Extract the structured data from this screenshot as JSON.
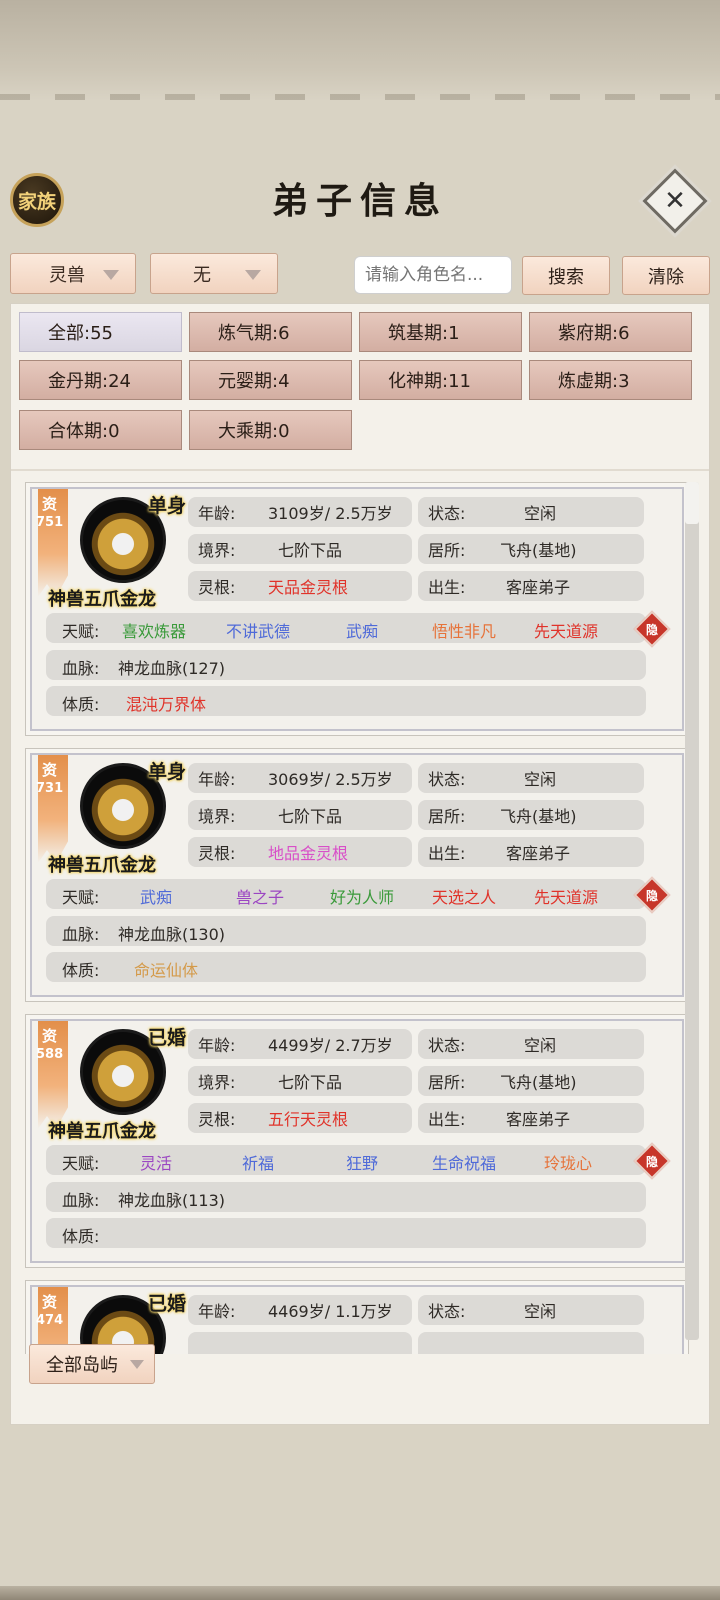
{
  "header": {
    "clan_badge": "家族",
    "title": "弟子信息",
    "close_icon": "close-icon"
  },
  "filters": {
    "type_dropdown": "灵兽",
    "sub_dropdown": "无",
    "search_placeholder": "请输入角色名...",
    "search_button": "搜索",
    "clear_button": "清除"
  },
  "realm_tabs": [
    {
      "label": "全部:55",
      "active": true
    },
    {
      "label": "炼气期:6"
    },
    {
      "label": "筑基期:1"
    },
    {
      "label": "紫府期:6"
    },
    {
      "label": "金丹期:24"
    },
    {
      "label": "元婴期:4"
    },
    {
      "label": "化神期:11"
    },
    {
      "label": "炼虚期:3"
    },
    {
      "label": "合体期:0"
    },
    {
      "label": "大乘期:0"
    }
  ],
  "labels": {
    "age": "年龄:",
    "status": "状态:",
    "realm": "境界:",
    "residence": "居所:",
    "root": "灵根:",
    "origin": "出生:",
    "talent": "天赋:",
    "bloodline": "血脉:",
    "physique": "体质:",
    "aptitude": "资",
    "hidden": "隐"
  },
  "disciples": [
    {
      "aptitude": "751",
      "marital": "单身",
      "species": "神兽五爪金龙",
      "age": "3109岁/ 2.5万岁",
      "status": "空闲",
      "realm": "七阶下品",
      "residence": "飞舟(基地)",
      "root": "天品金灵根",
      "root_color": "#e0332a",
      "origin": "客座弟子",
      "talents": [
        {
          "text": "喜欢炼器",
          "color": "#3a9a3a"
        },
        {
          "text": "不讲武德",
          "color": "#4f6ad8"
        },
        {
          "text": "武痴",
          "color": "#4f6ad8"
        },
        {
          "text": "悟性非凡",
          "color": "#e6733a"
        },
        {
          "text": "先天道源",
          "color": "#e0332a"
        }
      ],
      "bloodline": "神龙血脉(127)",
      "physique": "混沌万界体",
      "physique_color": "#e0332a"
    },
    {
      "aptitude": "731",
      "marital": "单身",
      "species": "神兽五爪金龙",
      "age": "3069岁/ 2.5万岁",
      "status": "空闲",
      "realm": "七阶下品",
      "residence": "飞舟(基地)",
      "root": "地品金灵根",
      "root_color": "#d84fc8",
      "origin": "客座弟子",
      "talents": [
        {
          "text": "武痴",
          "color": "#4f6ad8"
        },
        {
          "text": "兽之子",
          "color": "#9b46c2"
        },
        {
          "text": "好为人师",
          "color": "#3a9a3a"
        },
        {
          "text": "天选之人",
          "color": "#e0332a"
        },
        {
          "text": "先天道源",
          "color": "#e0332a"
        }
      ],
      "bloodline": "神龙血脉(130)",
      "physique": "命运仙体",
      "physique_color": "#d49a4a"
    },
    {
      "aptitude": "588",
      "marital": "已婚",
      "species": "神兽五爪金龙",
      "age": "4499岁/ 2.7万岁",
      "status": "空闲",
      "realm": "七阶下品",
      "residence": "飞舟(基地)",
      "root": "五行天灵根",
      "root_color": "#e0332a",
      "origin": "客座弟子",
      "talents": [
        {
          "text": "灵活",
          "color": "#9b46c2"
        },
        {
          "text": "祈福",
          "color": "#4f6ad8"
        },
        {
          "text": "狂野",
          "color": "#4f6ad8"
        },
        {
          "text": "生命祝福",
          "color": "#4f6ad8"
        },
        {
          "text": "玲珑心",
          "color": "#e6733a"
        }
      ],
      "bloodline": "神龙血脉(113)",
      "physique": "",
      "physique_color": "#2e2a26"
    },
    {
      "aptitude": "474",
      "marital": "已婚",
      "species": "",
      "age": "4469岁/ 1.1万岁",
      "status": "空闲"
    }
  ],
  "island_dropdown": "全部岛屿"
}
